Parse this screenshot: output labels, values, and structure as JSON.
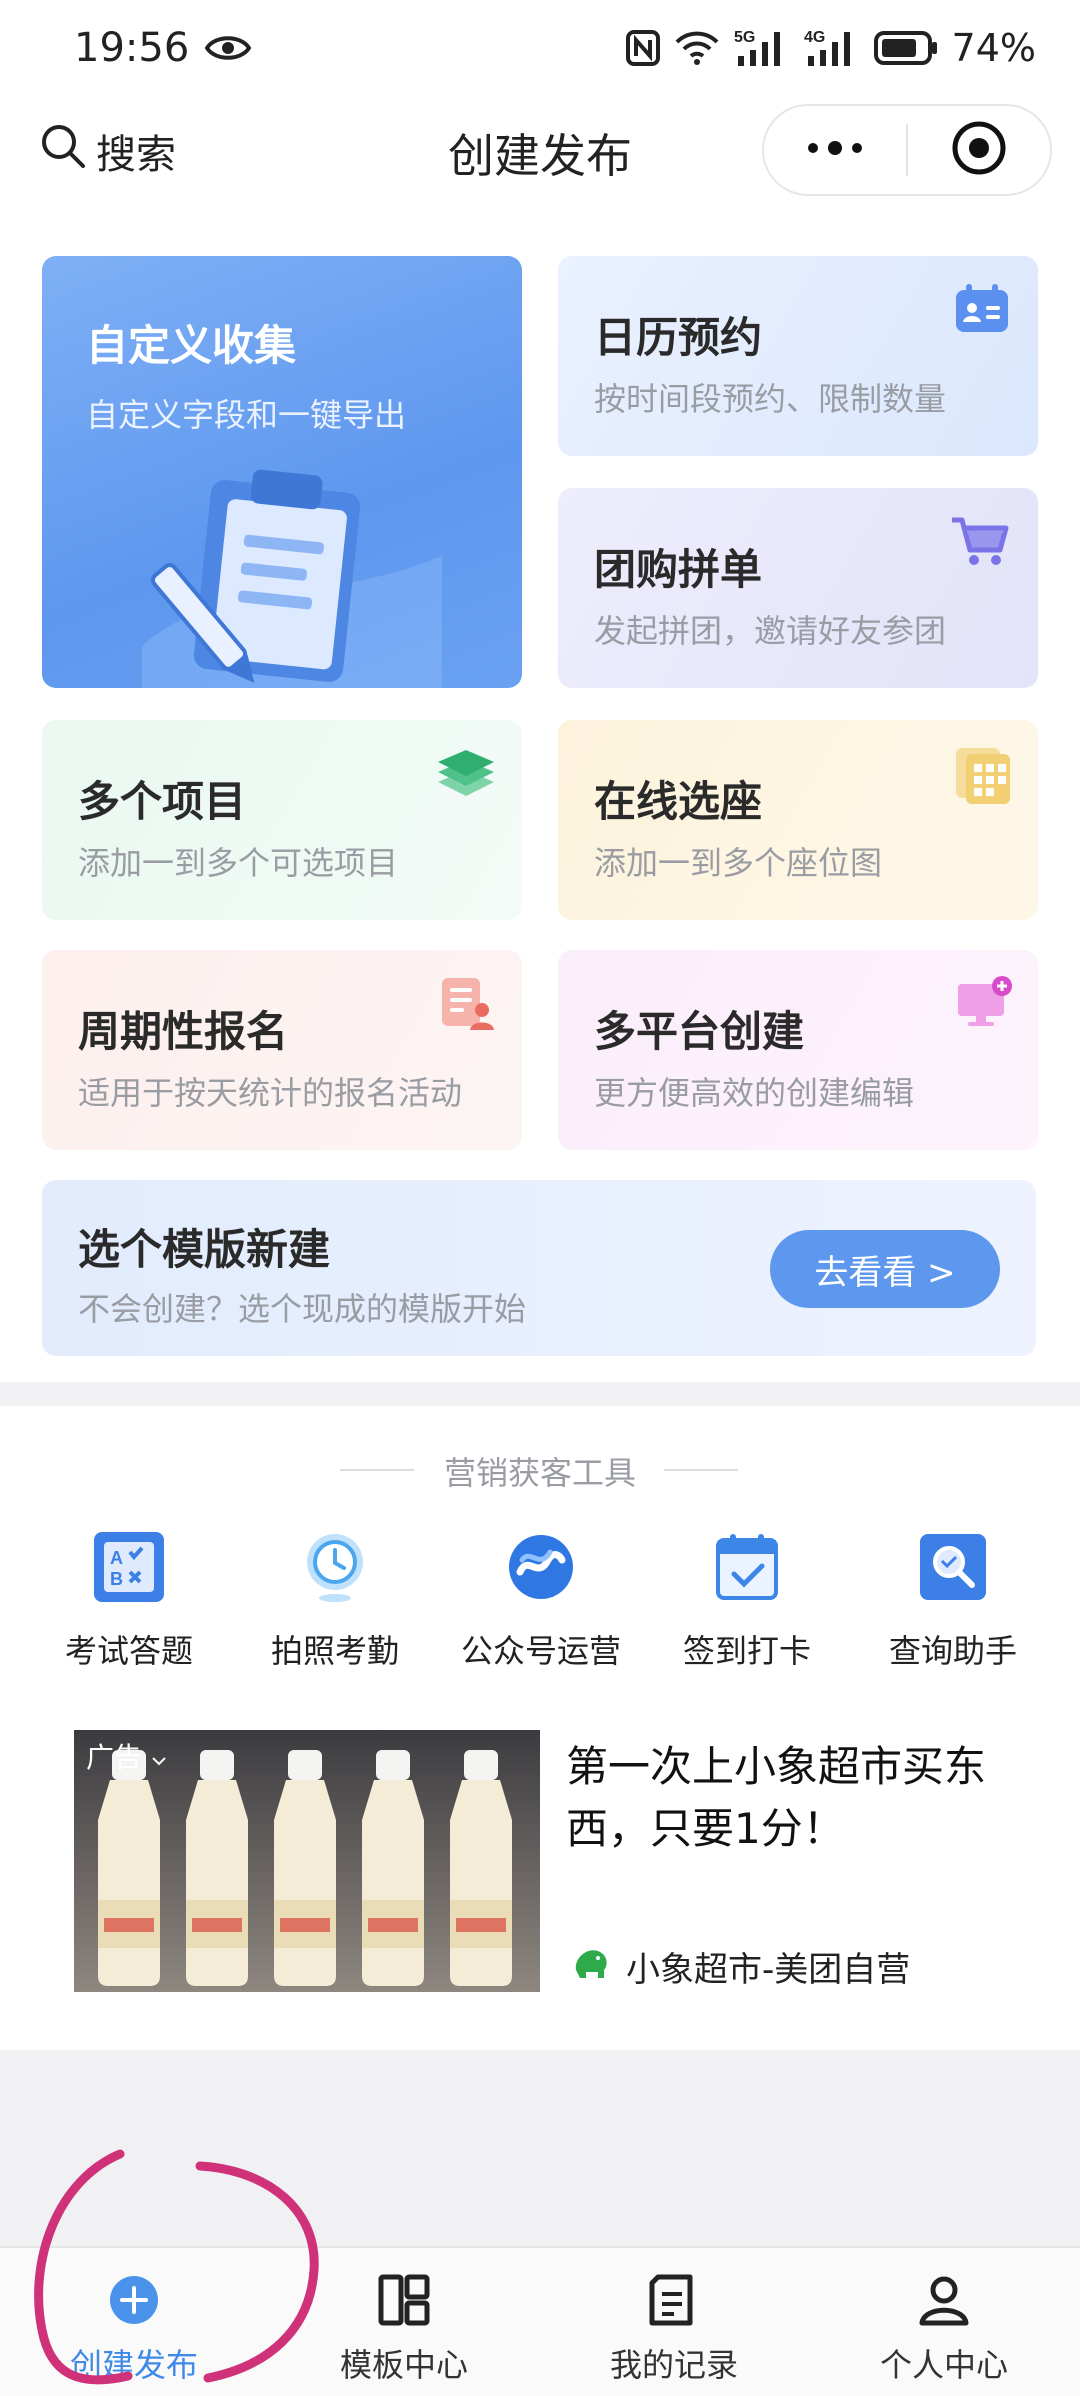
{
  "status_bar": {
    "time": "19:56",
    "network_5g": "5G",
    "network_4g": "4G",
    "battery": "74%"
  },
  "header": {
    "search_label": "搜索",
    "title": "创建发布"
  },
  "cards": {
    "custom": {
      "title": "自定义收集",
      "subtitle": "自定义字段和一键导出"
    },
    "calendar": {
      "title": "日历预约",
      "subtitle": "按时间段预约、限制数量"
    },
    "group": {
      "title": "团购拼单",
      "subtitle": "发起拼团，邀请好友参团"
    },
    "multi": {
      "title": "多个项目",
      "subtitle": "添加一到多个可选项目"
    },
    "seat": {
      "title": "在线选座",
      "subtitle": "添加一到多个座位图"
    },
    "periodic": {
      "title": "周期性报名",
      "subtitle": "适用于按天统计的报名活动"
    },
    "platform": {
      "title": "多平台创建",
      "subtitle": "更方便高效的创建编辑"
    },
    "template": {
      "title": "选个模版新建",
      "subtitle": "不会创建？选个现成的模版开始",
      "button": "去看看 >"
    }
  },
  "marketing": {
    "section_title": "营销获客工具",
    "tools": [
      {
        "label": "考试答题",
        "icon": "exam-icon"
      },
      {
        "label": "拍照考勤",
        "icon": "clock-icon"
      },
      {
        "label": "公众号运营",
        "icon": "official-account-icon"
      },
      {
        "label": "签到打卡",
        "icon": "checkin-calendar-icon"
      },
      {
        "label": "查询助手",
        "icon": "query-search-icon"
      }
    ]
  },
  "ad": {
    "badge": "广告",
    "headline": "第一次上小象超市买东西，只要1分！",
    "brand": "小象超市-美团自营"
  },
  "tabbar": {
    "items": [
      {
        "label": "创建发布",
        "icon": "plus-circle-icon",
        "active": true
      },
      {
        "label": "模板中心",
        "icon": "layout-grid-icon",
        "active": false
      },
      {
        "label": "我的记录",
        "icon": "document-list-icon",
        "active": false
      },
      {
        "label": "个人中心",
        "icon": "person-icon",
        "active": false
      }
    ]
  },
  "colors": {
    "accent": "#5e97ee",
    "active_tab": "#3f8ae8",
    "annotation": "#d0327a"
  }
}
